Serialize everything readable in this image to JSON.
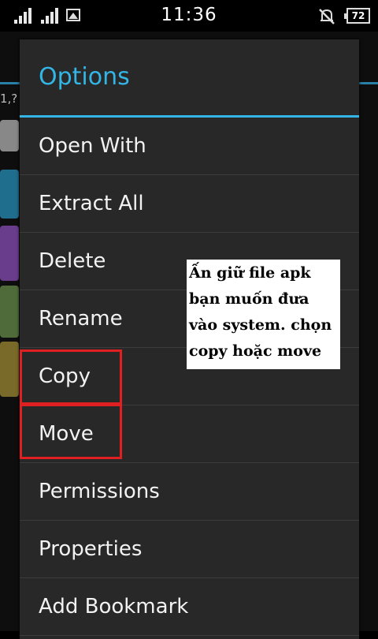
{
  "status_bar": {
    "time": "11:36",
    "battery": "72",
    "icons": [
      "signal-icon",
      "signal-icon",
      "gallery-icon",
      "mute-icon",
      "battery-icon"
    ]
  },
  "background": {
    "text": "1,?"
  },
  "dialog": {
    "title": "Options",
    "items": [
      {
        "label": "Open With"
      },
      {
        "label": "Extract All"
      },
      {
        "label": "Delete"
      },
      {
        "label": "Rename"
      },
      {
        "label": "Copy"
      },
      {
        "label": "Move"
      },
      {
        "label": "Permissions"
      },
      {
        "label": "Properties"
      },
      {
        "label": "Add Bookmark"
      }
    ]
  },
  "annotation": {
    "note": "Ấn giữ file apk bạn muốn đưa vào system. chọn copy hoặc move",
    "border_color": "#e02020"
  },
  "colors": {
    "accent": "#33b5e5",
    "dialog_bg": "#282828"
  }
}
